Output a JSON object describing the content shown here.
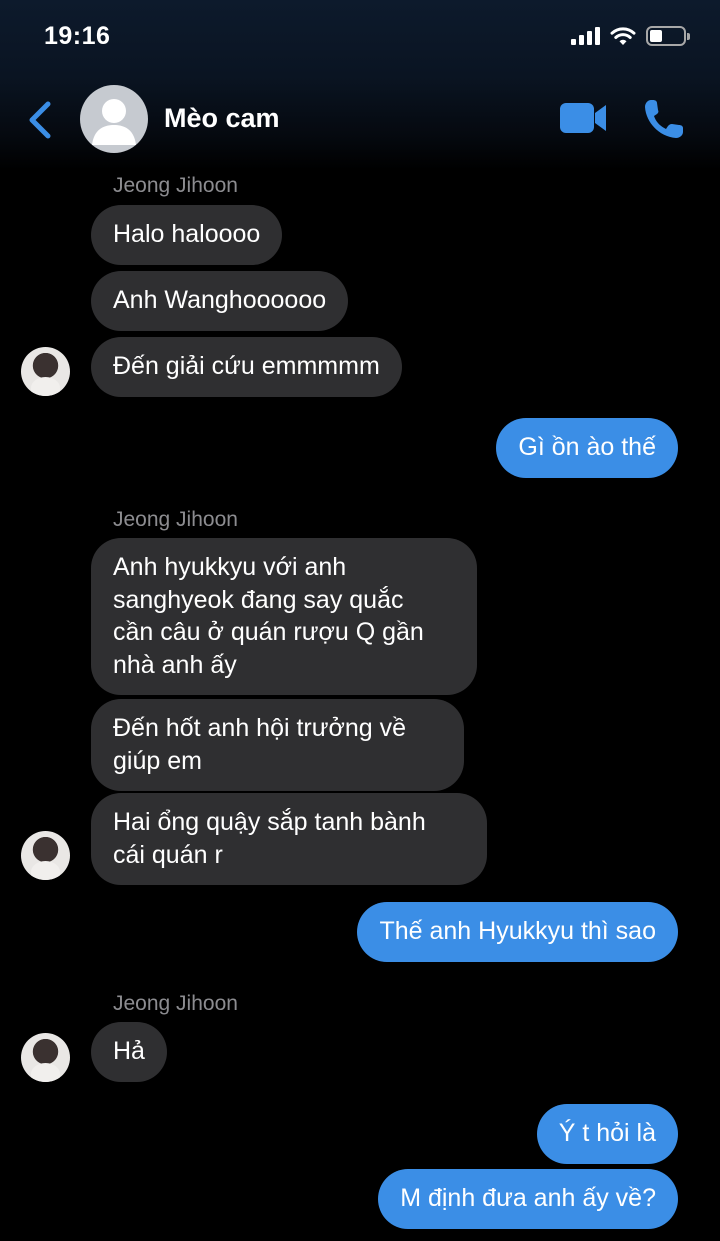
{
  "status_bar": {
    "time": "19:16"
  },
  "header": {
    "contact_name": "Mèo cam",
    "back_icon": "chevron-left-icon",
    "video_icon": "video-camera-icon",
    "call_icon": "phone-icon",
    "accent_color": "#3b8ee6"
  },
  "messages": {
    "group1": {
      "sender": "Jeong Jihoon",
      "lines": [
        "Halo haloooo",
        "Anh Wanghoooooo",
        "Đến giải cứu emmmmm"
      ]
    },
    "out1": "Gì ồn ào thế",
    "group2": {
      "sender": "Jeong Jihoon",
      "msg1_lines": [
        "Anh hyukkyu với anh",
        "sanghyeok đang say quắc",
        "cần câu ở quán rượu Q gần",
        "nhà anh ấy"
      ],
      "msg2_lines": [
        "Đến hốt anh hội trưởng về",
        "giúp em"
      ],
      "msg3_lines": [
        "Hai ổng quậy sắp tanh bành",
        "cái quán r"
      ]
    },
    "out2": "Thế anh Hyukkyu thì sao",
    "group3": {
      "sender": "Jeong Jihoon",
      "line": "Hả"
    },
    "out3": "Ý t hỏi là",
    "out4": "M định đưa anh ấy về?"
  },
  "colors": {
    "incoming_bubble": "#2f2f31",
    "outgoing_bubble": "#3b8ee6",
    "sender_name": "#8c8c90"
  }
}
